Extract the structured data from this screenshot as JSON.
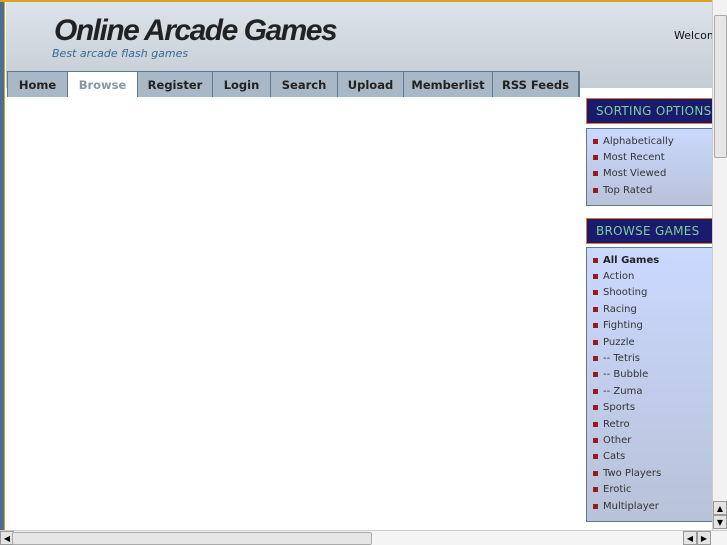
{
  "header": {
    "title": "Online Arcade Games",
    "tagline": "Best arcade flash games",
    "welcome": "Welcome"
  },
  "nav": {
    "tabs": [
      {
        "label": "Home"
      },
      {
        "label": "Browse",
        "active": true
      },
      {
        "label": "Register"
      },
      {
        "label": "Login"
      },
      {
        "label": "Search"
      },
      {
        "label": "Upload"
      },
      {
        "label": "Memberlist"
      },
      {
        "label": "RSS Feeds"
      }
    ]
  },
  "sidebar": {
    "sorting": {
      "title": "SORTING OPTIONS",
      "items": [
        "Alphabetically",
        "Most Recent",
        "Most Viewed",
        "Top Rated"
      ]
    },
    "browse": {
      "title": "BROWSE GAMES",
      "items": [
        "All Games",
        "Action",
        "Shooting",
        "Racing",
        "Fighting",
        "Puzzle",
        "-- Tetris",
        "-- Bubble",
        "-- Zuma",
        "Sports",
        "Retro",
        "Other",
        "Cats",
        "Two Players",
        "Erotic",
        "Multiplayer"
      ]
    }
  },
  "colors": {
    "accent": "#1a1a6e",
    "bullet": "#9a1a1a",
    "border": "#e0762a"
  }
}
